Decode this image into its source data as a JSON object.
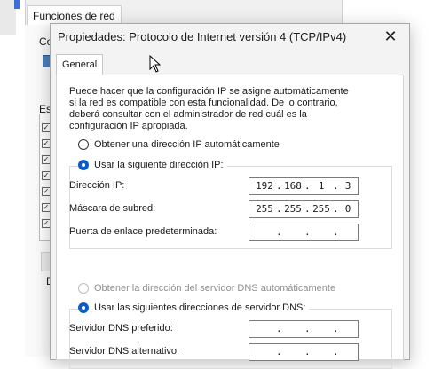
{
  "background": {
    "tab_label": "Funciones de red",
    "frag_co": "Co",
    "frag_est": "Est",
    "frag_d": "D"
  },
  "dialog": {
    "title": "Propiedades: Protocolo de Internet versión 4 (TCP/IPv4)",
    "close_glyph": "✕",
    "tab_general": "General",
    "description": "Puede hacer que la configuración IP se asigne automáticamente si la red es compatible con esta funcionalidad. De lo contrario, deberá consultar con el administrador de red cuál es la configuración IP apropiada.",
    "ip_auto_label": "Obtener una dirección IP automáticamente",
    "ip_manual_label": "Usar la siguiente dirección IP:",
    "ip_address_label": "Dirección IP:",
    "ip_address": [
      "192",
      "168",
      "1",
      "3"
    ],
    "subnet_label": "Máscara de subred:",
    "subnet": [
      "255",
      "255",
      "255",
      "0"
    ],
    "gateway_label": "Puerta de enlace predeterminada:",
    "gateway": [
      "",
      "",
      "",
      ""
    ],
    "dns_auto_label": "Obtener la dirección del servidor DNS automáticamente",
    "dns_manual_label": "Usar las siguientes direcciones de servidor DNS:",
    "dns_preferred_label": "Servidor DNS preferido:",
    "dns_preferred": [
      "",
      "",
      "",
      ""
    ],
    "dns_alternate_label": "Servidor DNS alternativo:",
    "dns_alternate": [
      "",
      "",
      "",
      ""
    ],
    "ip_mode": "manual",
    "dns_mode": "manual"
  },
  "colors": {
    "accent": "#0a5cc8",
    "disabled_text": "#8e8e8e"
  }
}
